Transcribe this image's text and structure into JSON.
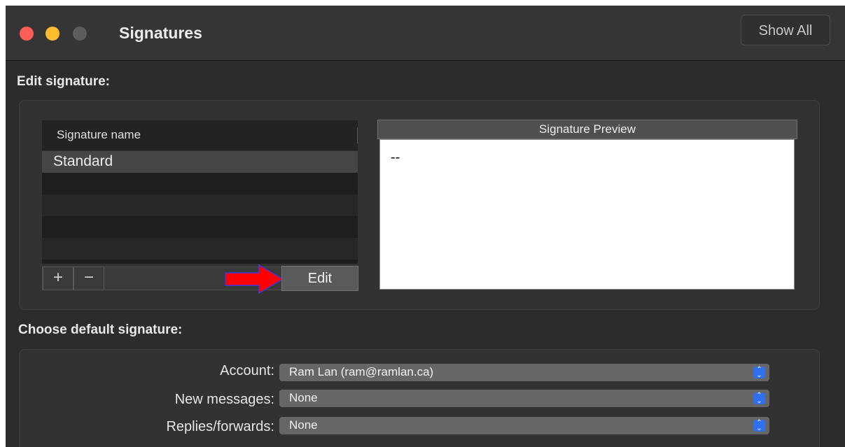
{
  "window": {
    "title": "Signatures",
    "show_all_label": "Show All"
  },
  "edit_section": {
    "label": "Edit signature:",
    "table": {
      "column_header": "Signature name",
      "rows": [
        "Standard"
      ]
    },
    "buttons": {
      "add": "+",
      "remove": "−",
      "edit": "Edit"
    },
    "preview": {
      "header": "Signature Preview",
      "content": "--"
    }
  },
  "default_section": {
    "label": "Choose default signature:",
    "fields": [
      {
        "label": "Account:",
        "value": "Ram Lan (ram@ramlan.ca)"
      },
      {
        "label": "New messages:",
        "value": "None"
      },
      {
        "label": "Replies/forwards:",
        "value": "None"
      }
    ]
  },
  "colors": {
    "window_bg": "#2c2c2c",
    "close": "#ff5f57",
    "minimize": "#febc2e",
    "zoom_disabled": "#5c5c5c",
    "annotation_arrow": "#ff0000",
    "stepper_accent": "#2f6ff0"
  },
  "icons": {
    "annotation": "red-arrow-icon",
    "select_stepper": "chevron-updown-icon"
  }
}
